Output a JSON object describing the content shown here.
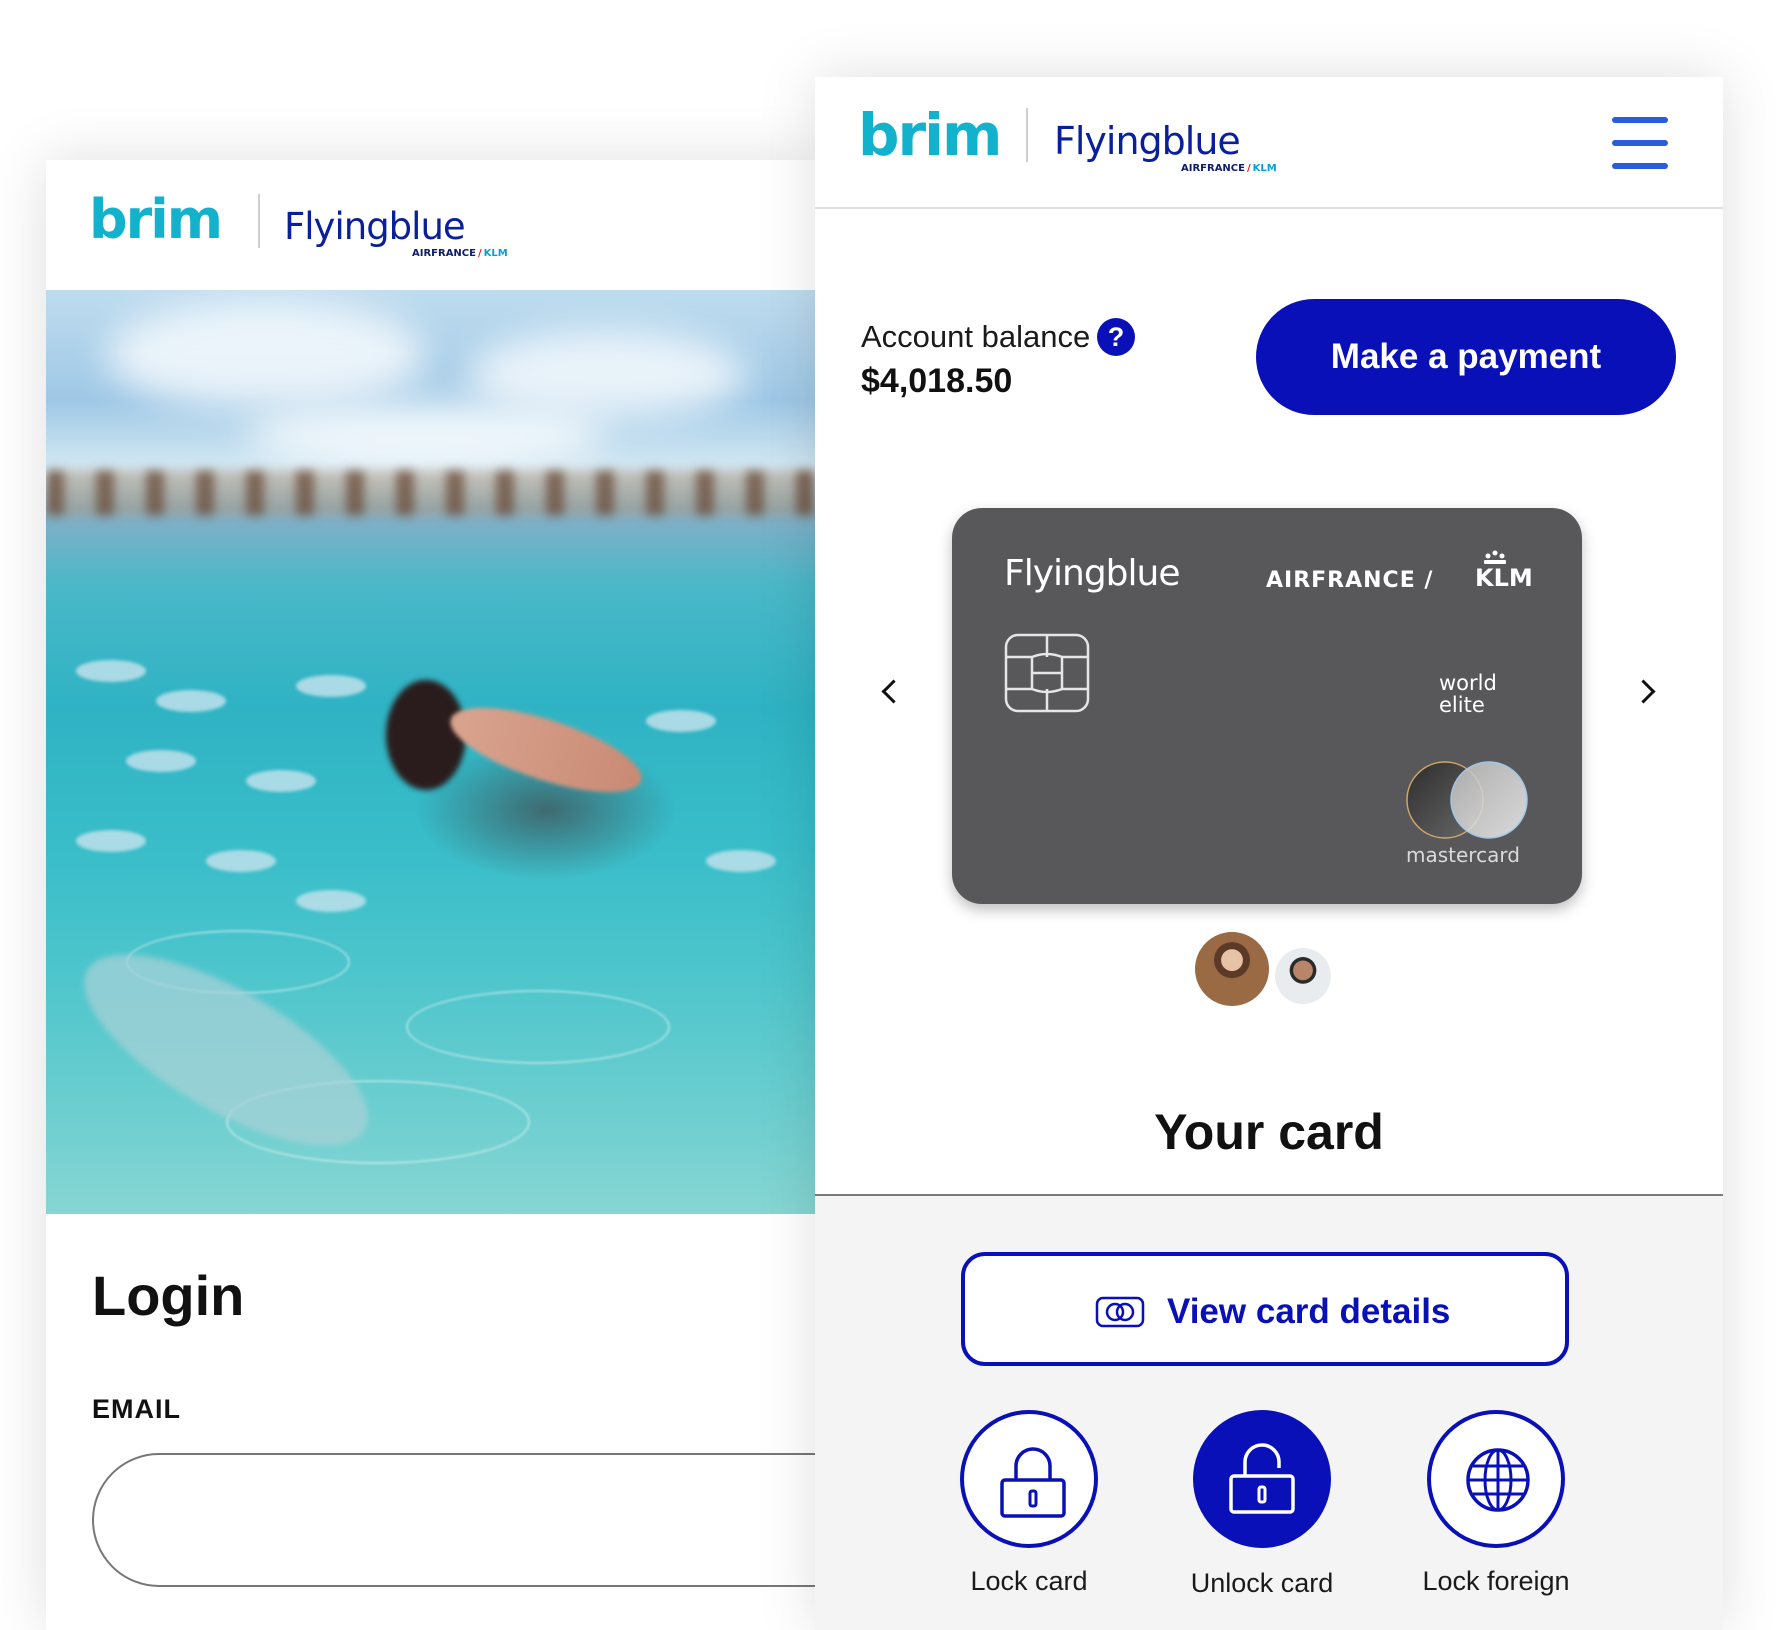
{
  "branding": {
    "brim": "brim",
    "flyingblue": "Flyingblue",
    "airfrance": "AIRFRANCE",
    "klm": "KLM"
  },
  "login": {
    "title": "Login",
    "email_label": "EMAIL",
    "email_value": "",
    "email_placeholder": ""
  },
  "dashboard": {
    "balance_label": "Account balance",
    "help_icon_glyph": "?",
    "balance_value": "$4,018.50",
    "payment_button": "Make a payment",
    "card": {
      "brand": "Flyingblue",
      "airline": "AIRFRANCE",
      "klm": "KLM",
      "tier_line1": "world",
      "tier_line2": "elite",
      "network": "mastercard"
    },
    "section_title": "Your card",
    "view_details_button": "View card details",
    "actions": [
      {
        "label": "Lock card",
        "icon": "lock-icon"
      },
      {
        "label": "Unlock card",
        "icon": "unlock-icon"
      },
      {
        "label": "Lock foreign",
        "icon": "globe-icon"
      }
    ]
  },
  "colors": {
    "brim_teal": "#12b2cc",
    "flyingblue_navy": "#0a1f9c",
    "primary_blue": "#0a10b8",
    "menu_blue": "#2a5ed9",
    "card_grey": "#58585b"
  }
}
